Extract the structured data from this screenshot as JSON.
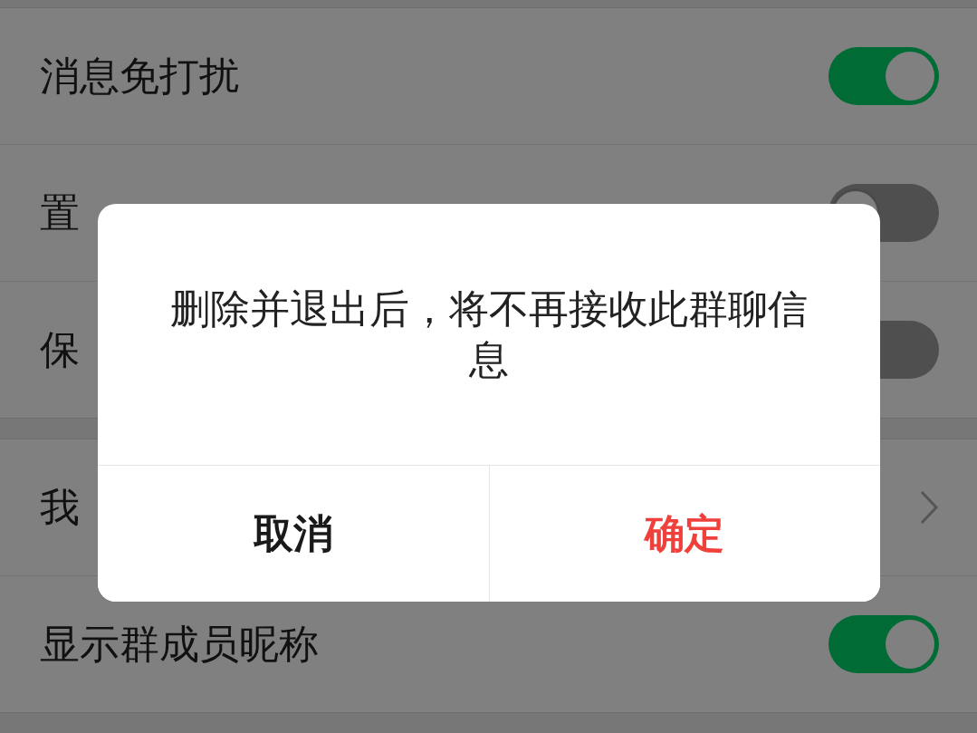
{
  "groups": [
    [
      {
        "kind": "toggle",
        "label": "消息免打扰",
        "on": true
      },
      {
        "kind": "toggle",
        "label": "置",
        "on": false
      },
      {
        "kind": "toggle",
        "label": "保",
        "on": false
      }
    ],
    [
      {
        "kind": "link",
        "label": "我"
      },
      {
        "kind": "toggle",
        "label": "显示群成员昵称",
        "on": true
      }
    ]
  ],
  "dialog": {
    "message": "删除并退出后，将不再接收此群聊信息",
    "buttons": [
      {
        "label": "取消",
        "kind": "cancel"
      },
      {
        "label": "确定",
        "kind": "confirm"
      }
    ]
  }
}
